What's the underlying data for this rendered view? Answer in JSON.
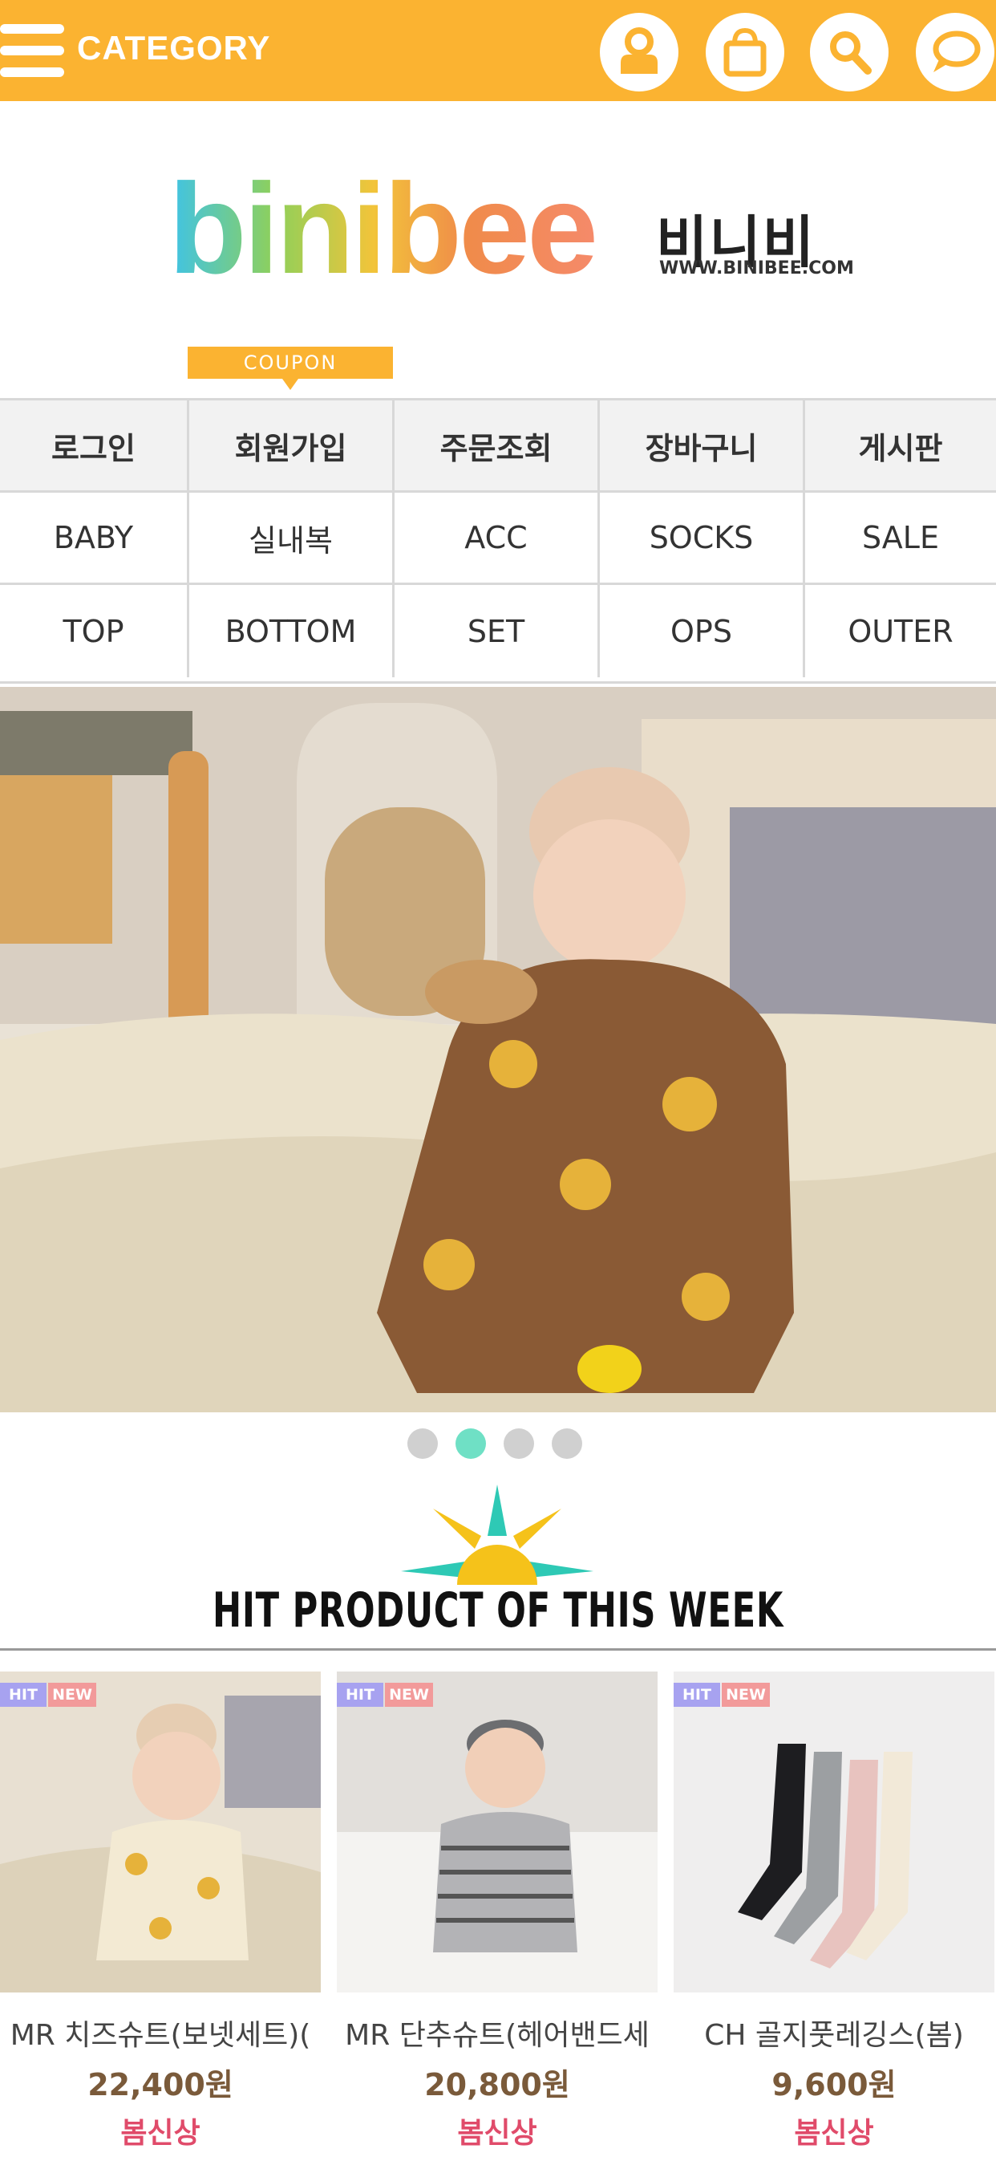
{
  "header": {
    "category_label": "CATEGORY",
    "background_color": "#fbb331",
    "icons": [
      "user-icon",
      "bag-icon",
      "search-icon",
      "chat-icon"
    ]
  },
  "logo": {
    "wordmark": "binibee",
    "korean": "비니비",
    "url": "WWW.BINIBEE.COM"
  },
  "coupon_label": "COUPON",
  "nav": {
    "rows": [
      [
        "로그인",
        "회원가입",
        "주문조회",
        "장바구니",
        "게시판"
      ],
      [
        "BABY",
        "실내복",
        "ACC",
        "SOCKS",
        "SALE"
      ],
      [
        "TOP",
        "BOTTOM",
        "SET",
        "OPS",
        "OUTER"
      ]
    ]
  },
  "carousel": {
    "total": 4,
    "active": 2
  },
  "section_title": "HIT PRODUCT OF THIS WEEK",
  "products": [
    {
      "badges": [
        "HIT",
        "NEW"
      ],
      "name": "MR 치즈슈트(보넷세트)(",
      "price": "22,400원",
      "tag": "봄신상"
    },
    {
      "badges": [
        "HIT",
        "NEW"
      ],
      "name": "MR 단추슈트(헤어밴드세",
      "price": "20,800원",
      "tag": "봄신상"
    },
    {
      "badges": [
        "HIT",
        "NEW"
      ],
      "name": "CH 골지풋레깅스(봄)",
      "price": "9,600원",
      "tag": "봄신상"
    }
  ]
}
